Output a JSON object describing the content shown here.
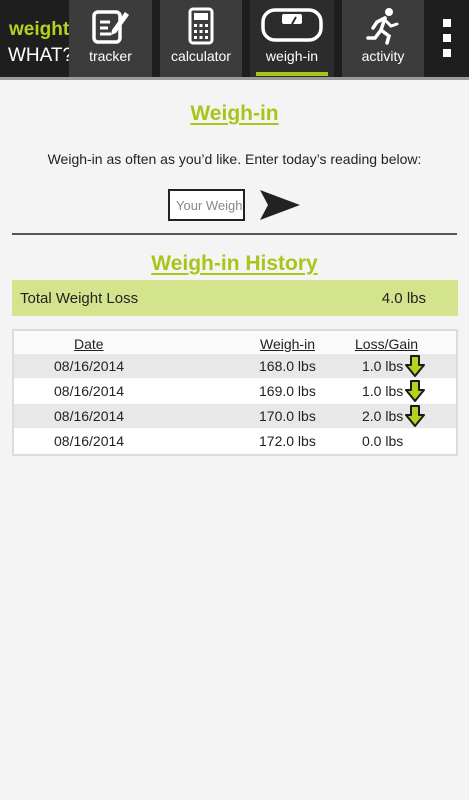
{
  "app": {
    "logo_line1": "weight",
    "logo_line2": "WHAT?"
  },
  "tabs": [
    {
      "label": "tracker",
      "icon": "notepad-pencil-icon"
    },
    {
      "label": "calculator",
      "icon": "calculator-icon"
    },
    {
      "label": "weigh-in",
      "icon": "scale-icon",
      "active": true
    },
    {
      "label": "activity",
      "icon": "running-person-icon"
    }
  ],
  "colors": {
    "accent": "#a8c51a",
    "total_bg": "#d4e48d",
    "topbar": "#1e1e1e"
  },
  "weigh_in": {
    "title": "Weigh-in",
    "intro": "Weigh-in as often as you’d like.  Enter today’s reading below:",
    "input_placeholder": "Your Weight",
    "input_value": ""
  },
  "history": {
    "title": "Weigh-in History",
    "total_label": "Total Weight Loss",
    "total_value": "4.0 lbs",
    "columns": [
      "Date",
      "Weigh-in",
      "Loss/Gain"
    ],
    "rows": [
      {
        "date": "08/16/2014",
        "weight": "168.0 lbs",
        "change": "1.0 lbs",
        "direction": "down"
      },
      {
        "date": "08/16/2014",
        "weight": "169.0 lbs",
        "change": "1.0 lbs",
        "direction": "down"
      },
      {
        "date": "08/16/2014",
        "weight": "170.0 lbs",
        "change": "2.0 lbs",
        "direction": "down"
      },
      {
        "date": "08/16/2014",
        "weight": "172.0 lbs",
        "change": "0.0 lbs",
        "direction": "none"
      }
    ]
  }
}
